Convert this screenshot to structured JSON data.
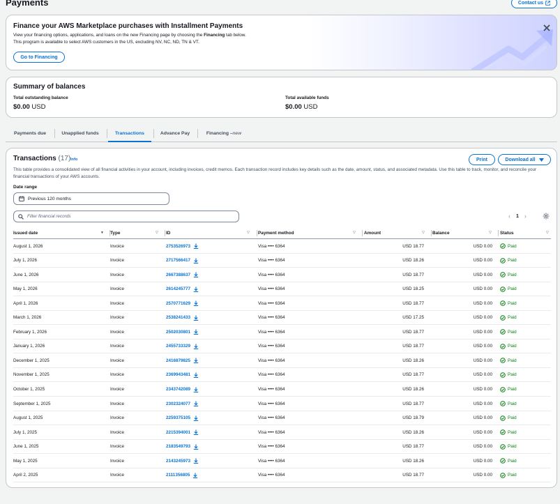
{
  "page": {
    "title": "Payments",
    "contact_label": "Contact us"
  },
  "banner": {
    "title": "Finance your AWS Marketplace purchases with Installment Payments",
    "text_before_bold": "View your financing options, applications, and loans on the new Financing page by choosing the ",
    "text_bold": "Financing",
    "text_after_bold": " tab below.",
    "text_line2": "This program is available to select AWS customers in the US, excluding NV, NC, ND, TN & VT.",
    "button_label": "Go to Financing"
  },
  "summary": {
    "title": "Summary of balances",
    "outstanding_label": "Total outstanding balance",
    "outstanding_value": "$0.00",
    "outstanding_currency": "USD",
    "available_label": "Total available funds",
    "available_value": "$0.00",
    "available_currency": "USD"
  },
  "tabs": {
    "payments_due": "Payments due",
    "unapplied_funds": "Unapplied funds",
    "transactions": "Transactions",
    "advance_pay": "Advance Pay",
    "financing": "Financing – ",
    "financing_new": "new"
  },
  "transactions": {
    "title": "Transactions",
    "count": "(17)",
    "info": "Info",
    "description": "This table provides a consolidated view of all financial activities in your account, including invoices, credit memos. Each transaction record includes key details such as the date, amount, status, and associated metadata. Use this table to track, monitor, and reconcile your financial transactions of your AWS accounts.",
    "print_label": "Print",
    "download_label": "Download all",
    "date_range_label": "Date range",
    "date_range_value": "Previous 120 months",
    "filter_placeholder": "Filter financial records",
    "page_number": "1",
    "columns": {
      "issued_date": "Issued date",
      "type": "Type",
      "id": "ID",
      "payment_method": "Payment method",
      "amount": "Amount",
      "balance": "Balance",
      "status": "Status"
    },
    "rows": [
      {
        "date": "August 1, 2026",
        "type": "Invoice",
        "id": "2753526973",
        "method": "Visa •••• 6364",
        "amount": "USD 18.77",
        "balance": "USD 0.00",
        "status": "Paid"
      },
      {
        "date": "July 1, 2026",
        "type": "Invoice",
        "id": "2717566417",
        "method": "Visa •••• 6364",
        "amount": "USD 18.26",
        "balance": "USD 0.00",
        "status": "Paid"
      },
      {
        "date": "June 1, 2026",
        "type": "Invoice",
        "id": "2667388637",
        "method": "Visa •••• 6364",
        "amount": "USD 18.77",
        "balance": "USD 0.00",
        "status": "Paid"
      },
      {
        "date": "May 1, 2026",
        "type": "Invoice",
        "id": "2614245777",
        "method": "Visa •••• 6364",
        "amount": "USD 18.25",
        "balance": "USD 0.00",
        "status": "Paid"
      },
      {
        "date": "April 1, 2026",
        "type": "Invoice",
        "id": "2570771629",
        "method": "Visa •••• 6364",
        "amount": "USD 18.77",
        "balance": "USD 0.00",
        "status": "Paid"
      },
      {
        "date": "March 1, 2026",
        "type": "Invoice",
        "id": "2538241433",
        "method": "Visa •••• 6364",
        "amount": "USD 17.25",
        "balance": "USD 0.00",
        "status": "Paid"
      },
      {
        "date": "February 1, 2026",
        "type": "Invoice",
        "id": "2502030801",
        "method": "Visa •••• 6364",
        "amount": "USD 18.77",
        "balance": "USD 0.00",
        "status": "Paid"
      },
      {
        "date": "January 1, 2026",
        "type": "Invoice",
        "id": "2455733329",
        "method": "Visa •••• 6364",
        "amount": "USD 18.77",
        "balance": "USD 0.00",
        "status": "Paid"
      },
      {
        "date": "December 1, 2025",
        "type": "Invoice",
        "id": "2416879825",
        "method": "Visa •••• 6364",
        "amount": "USD 18.26",
        "balance": "USD 0.00",
        "status": "Paid"
      },
      {
        "date": "November 1, 2025",
        "type": "Invoice",
        "id": "2369943481",
        "method": "Visa •••• 6364",
        "amount": "USD 18.77",
        "balance": "USD 0.00",
        "status": "Paid"
      },
      {
        "date": "October 1, 2025",
        "type": "Invoice",
        "id": "2343742089",
        "method": "Visa •••• 6364",
        "amount": "USD 18.26",
        "balance": "USD 0.00",
        "status": "Paid"
      },
      {
        "date": "September 1, 2025",
        "type": "Invoice",
        "id": "2302324077",
        "method": "Visa •••• 6364",
        "amount": "USD 18.77",
        "balance": "USD 0.00",
        "status": "Paid"
      },
      {
        "date": "August 1, 2025",
        "type": "Invoice",
        "id": "2259375105",
        "method": "Visa •••• 6364",
        "amount": "USD 18.79",
        "balance": "USD 0.00",
        "status": "Paid"
      },
      {
        "date": "July 1, 2025",
        "type": "Invoice",
        "id": "2215394001",
        "method": "Visa •••• 6364",
        "amount": "USD 18.26",
        "balance": "USD 0.00",
        "status": "Paid"
      },
      {
        "date": "June 1, 2025",
        "type": "Invoice",
        "id": "2183549793",
        "method": "Visa •••• 6364",
        "amount": "USD 18.77",
        "balance": "USD 0.00",
        "status": "Paid"
      },
      {
        "date": "May 1, 2025",
        "type": "Invoice",
        "id": "2143245973",
        "method": "Visa •••• 6364",
        "amount": "USD 18.26",
        "balance": "USD 0.00",
        "status": "Paid"
      },
      {
        "date": "April 2, 2025",
        "type": "Invoice",
        "id": "2111356805",
        "method": "Visa •••• 6364",
        "amount": "USD 18.77",
        "balance": "USD 0.00",
        "status": "Paid"
      }
    ]
  },
  "colors": {
    "accent": "#0972d3",
    "success": "#037f0c",
    "text": "#16191f",
    "border": "#c6c6cd"
  },
  "icons": [
    "external-link-icon",
    "close-icon",
    "calendar-icon",
    "search-icon",
    "settings-icon",
    "download-icon",
    "status-success-icon",
    "caret-down-icon"
  ]
}
